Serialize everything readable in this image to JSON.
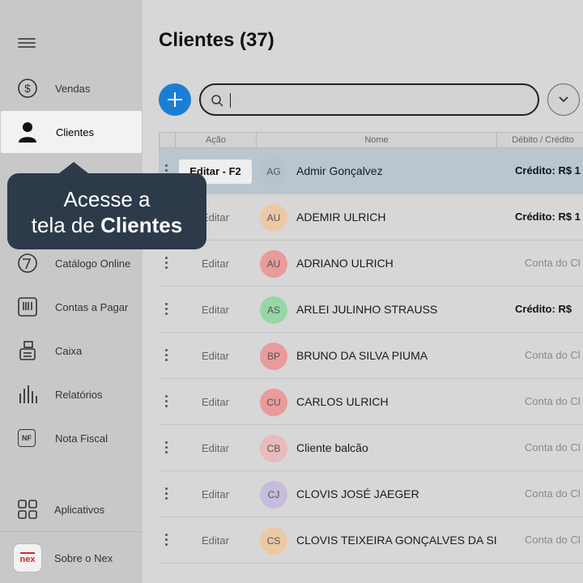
{
  "sidebar": {
    "items": [
      {
        "label": "Vendas",
        "icon": "dollar-circle-icon"
      },
      {
        "label": "Clientes",
        "icon": "person-icon"
      },
      {
        "label": "Catálogo Online",
        "icon": "catalog-icon"
      },
      {
        "label": "Contas a Pagar",
        "icon": "barcode-icon"
      },
      {
        "label": "Caixa",
        "icon": "cash-register-icon"
      },
      {
        "label": "Relatórios",
        "icon": "bar-chart-icon"
      },
      {
        "label": "Nota Fiscal",
        "icon": "nf-icon"
      },
      {
        "label": "Aplicativos",
        "icon": "apps-grid-icon"
      },
      {
        "label": "Sobre o Nex",
        "icon": "nex-logo"
      }
    ],
    "nf_text": "NF",
    "logo_text": "nex"
  },
  "tooltip": {
    "line1": "Acesse a",
    "line2_prefix": "tela de ",
    "line2_bold": "Clientes"
  },
  "main": {
    "title": "Clientes (37)",
    "search": {
      "value": "",
      "placeholder": ""
    }
  },
  "table": {
    "headers": [
      "Ação",
      "Nome",
      "Débito / Crédito"
    ],
    "edit_selected": "Editar - F2",
    "edit_label": "Editar",
    "rows": [
      {
        "initials": "AG",
        "name": "Admir Gonçalvez",
        "debit": "Crédito: R$ 1",
        "kind": "credit",
        "color": "#b6c2cc",
        "selected": true
      },
      {
        "initials": "AU",
        "name": "ADEMIR ULRICH",
        "debit": "Crédito: R$ 1",
        "kind": "credit",
        "color": "#ecc9a6"
      },
      {
        "initials": "AU",
        "name": "ADRIANO ULRICH",
        "debit": "Conta do Cl",
        "kind": "account",
        "color": "#ea9a9a"
      },
      {
        "initials": "AS",
        "name": "ARLEI JULINHO STRAUSS",
        "debit": "Crédito: R$",
        "kind": "credit",
        "color": "#98d6a8"
      },
      {
        "initials": "BP",
        "name": "BRUNO DA SILVA PIUMA",
        "debit": "Conta do Cl",
        "kind": "account",
        "color": "#ea9a9a"
      },
      {
        "initials": "CU",
        "name": "CARLOS ULRICH",
        "debit": "Conta do Cl",
        "kind": "account",
        "color": "#ea9a9a"
      },
      {
        "initials": "CB",
        "name": "Cliente balcão",
        "debit": "Conta do Cl",
        "kind": "account",
        "color": "#e8bcbc"
      },
      {
        "initials": "CJ",
        "name": "CLOVIS JOSÉ JAEGER",
        "debit": "Conta do Cl",
        "kind": "account",
        "color": "#c6bcdc"
      },
      {
        "initials": "CS",
        "name": "CLOVIS TEIXEIRA GONÇALVES DA SILVA",
        "debit": "Conta do Cl",
        "kind": "account",
        "color": "#ecc9a6"
      }
    ]
  }
}
